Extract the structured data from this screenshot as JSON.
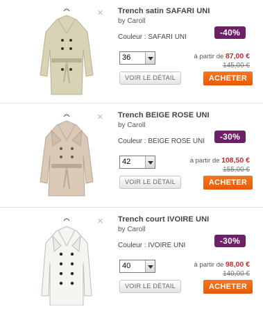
{
  "products": [
    {
      "title": "Trench satin SAFARI UNI",
      "brand": "by Caroll",
      "color": "Couleur : SAFARI UNI",
      "discount": "-40%",
      "size": "36",
      "price_prefix": "à partir de ",
      "price": "87,00 €",
      "old_price": "145,00 €",
      "detail_label": "VOIR LE DÉTAIL",
      "buy_label": "ACHETER",
      "close_glyph": "×",
      "coat_color": "#d8d3b4",
      "coat_shade": "#b8b296",
      "icon": "coat-image"
    },
    {
      "title": "Trench BEIGE ROSE UNI",
      "brand": "by Caroll",
      "color": "Couleur : BEIGE ROSE UNI",
      "discount": "-30%",
      "size": "42",
      "price_prefix": "à partir de ",
      "price": "108,50 €",
      "old_price": "155,00 €",
      "detail_label": "VOIR LE DÉTAIL",
      "buy_label": "ACHETER",
      "close_glyph": "×",
      "coat_color": "#d9c9b6",
      "coat_shade": "#bba894",
      "icon": "coat-image"
    },
    {
      "title": "Trench court IVOIRE UNI",
      "brand": "by Caroll",
      "color": "Couleur : IVOIRE UNI",
      "discount": "-30%",
      "size": "40",
      "price_prefix": "à partir de ",
      "price": "98,00 €",
      "old_price": "140,00 €",
      "detail_label": "VOIR LE DÉTAIL",
      "buy_label": "ACHETER",
      "close_glyph": "×",
      "coat_color": "#f4f4f1",
      "coat_shade": "#d6d6d2",
      "icon": "coat-image"
    }
  ],
  "colors": {
    "discount_badge": "#6d1f67",
    "buy_button": "#f26a12",
    "price_red": "#cc2a2a"
  }
}
